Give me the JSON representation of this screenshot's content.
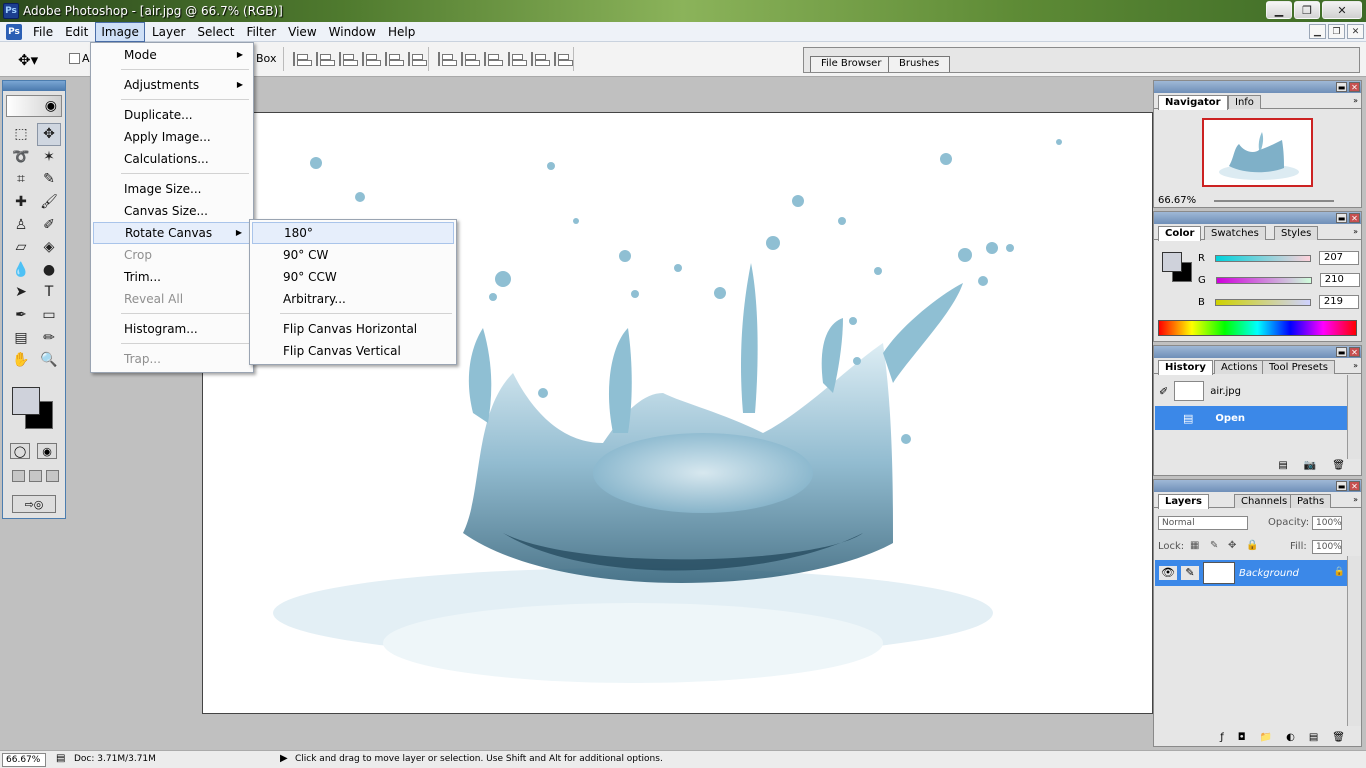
{
  "window": {
    "title": "Adobe Photoshop - [air.jpg @ 66.7% (RGB)]",
    "min_glyph": "▁",
    "max_glyph": "❐",
    "close_glyph": "✕"
  },
  "menubar": {
    "items": [
      "File",
      "Edit",
      "Image",
      "Layer",
      "Select",
      "Filter",
      "View",
      "Window",
      "Help"
    ],
    "active": "Image"
  },
  "options": {
    "auto_label": "Au",
    "box_label": "Box"
  },
  "palette_well": {
    "tabs": [
      "File Browser",
      "Brushes"
    ]
  },
  "image_menu": {
    "items": [
      {
        "label": "Mode",
        "submenu": true,
        "disabled": false
      },
      {
        "label": "Adjustments",
        "submenu": true,
        "disabled": false
      },
      {
        "label": "Duplicate...",
        "submenu": false,
        "disabled": false
      },
      {
        "label": "Apply Image...",
        "submenu": false,
        "disabled": false
      },
      {
        "label": "Calculations...",
        "submenu": false,
        "disabled": false
      },
      {
        "label": "Image Size...",
        "submenu": false,
        "disabled": false
      },
      {
        "label": "Canvas Size...",
        "submenu": false,
        "disabled": false
      },
      {
        "label": "Rotate Canvas",
        "submenu": true,
        "disabled": false,
        "highlighted": true
      },
      {
        "label": "Crop",
        "submenu": false,
        "disabled": true
      },
      {
        "label": "Trim...",
        "submenu": false,
        "disabled": false
      },
      {
        "label": "Reveal All",
        "submenu": false,
        "disabled": true
      },
      {
        "label": "Histogram...",
        "submenu": false,
        "disabled": false
      },
      {
        "label": "Trap...",
        "submenu": false,
        "disabled": true
      }
    ]
  },
  "rotate_menu": {
    "items": [
      "180°",
      "90° CW",
      "90° CCW",
      "Arbitrary...",
      "Flip Canvas Horizontal",
      "Flip Canvas Vertical"
    ],
    "highlighted": "180°"
  },
  "navigator": {
    "tabs": [
      "Navigator",
      "Info"
    ],
    "zoom": "66.67%"
  },
  "color": {
    "tabs": [
      "Color",
      "Swatches",
      "Styles"
    ],
    "r_label": "R",
    "g_label": "G",
    "b_label": "B",
    "r": "207",
    "g": "210",
    "b": "219",
    "foreground": "#cfd2db",
    "background": "#000000"
  },
  "history": {
    "tabs": [
      "History",
      "Actions",
      "Tool Presets"
    ],
    "snapshot": "air.jpg",
    "states": [
      "Open"
    ]
  },
  "layers": {
    "tabs": [
      "Layers",
      "Channels",
      "Paths"
    ],
    "blend_mode": "Normal",
    "opacity_label": "Opacity:",
    "opacity": "100%",
    "lock_label": "Lock:",
    "fill_label": "Fill:",
    "fill": "100%",
    "layer_name": "Background"
  },
  "status": {
    "zoom": "66.67%",
    "doc": "Doc: 3.71M/3.71M",
    "hint": "Click and drag to move layer or selection. Use Shift and Alt for additional options."
  },
  "colors": {
    "highlight": "#3b88e8",
    "water": "#6fa3bd"
  }
}
